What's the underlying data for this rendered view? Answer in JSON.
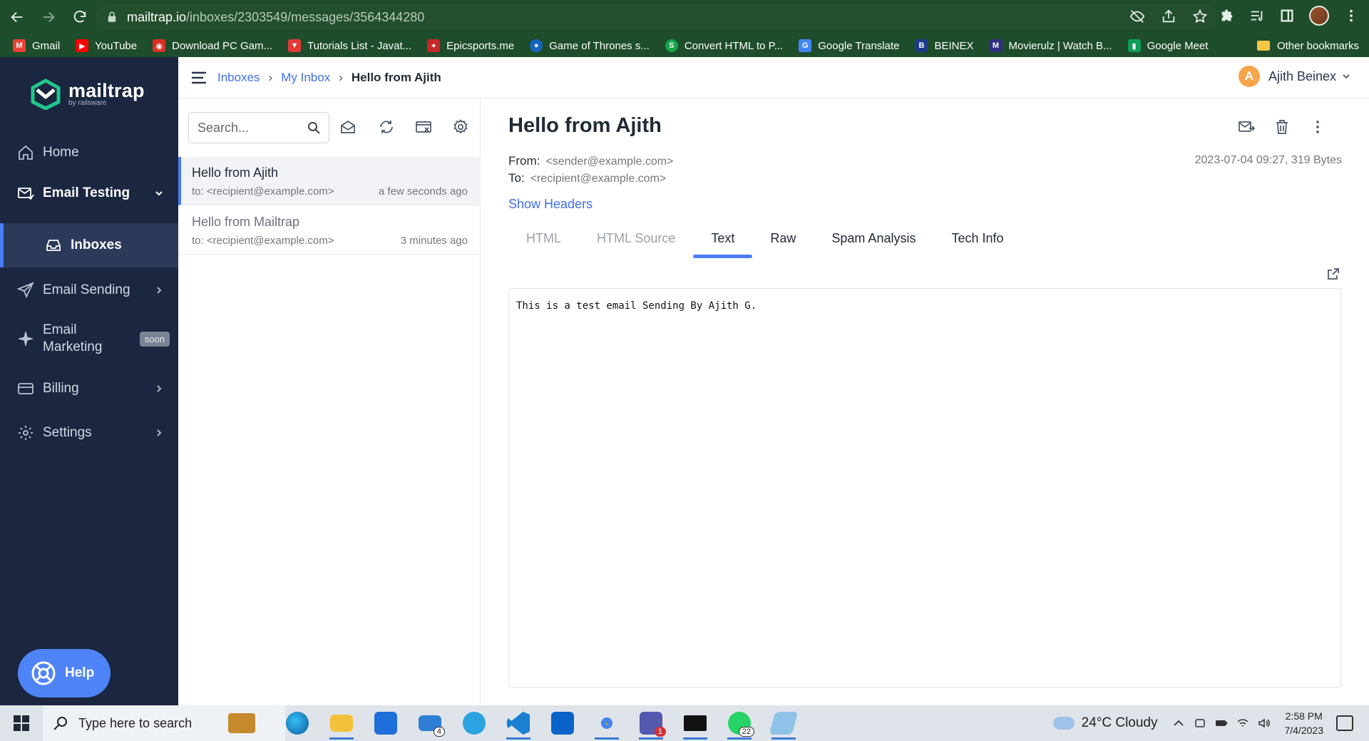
{
  "browser": {
    "url_host": "mailtrap.io",
    "url_path": "/inboxes/2303549/messages/3564344280",
    "bookmarks": [
      {
        "label": "Gmail",
        "color": "#ea4335",
        "glyph": "M"
      },
      {
        "label": "YouTube",
        "color": "#ff0000",
        "glyph": "▶"
      },
      {
        "label": "Download PC Gam...",
        "color": "#d93025",
        "glyph": "◉"
      },
      {
        "label": "Tutorials List - Javat...",
        "color": "#e53935",
        "glyph": "▼"
      },
      {
        "label": "Epicsports.me",
        "color": "#c62828",
        "glyph": "✦"
      },
      {
        "label": "Game of Thrones s...",
        "color": "#1565c0",
        "glyph": "●"
      },
      {
        "label": "Convert HTML to P...",
        "color": "#16a34a",
        "glyph": "S"
      },
      {
        "label": "Google Translate",
        "color": "#4285f4",
        "glyph": "G"
      },
      {
        "label": "BEINEX",
        "color": "#1e3a8a",
        "glyph": "B"
      },
      {
        "label": "Movierulz | Watch B...",
        "color": "#312e81",
        "glyph": "M"
      },
      {
        "label": "Google Meet",
        "color": "#0f9d58",
        "glyph": "▮"
      }
    ],
    "other_bookmarks": "Other bookmarks"
  },
  "sidebar": {
    "logo_name": "mailtrap",
    "logo_sub": "by railsware",
    "home": "Home",
    "email_testing": "Email Testing",
    "inboxes": "Inboxes",
    "email_sending": "Email Sending",
    "email_marketing_1": "Email",
    "email_marketing_2": "Marketing",
    "soon_badge": "soon",
    "billing": "Billing",
    "settings": "Settings",
    "help": "Help"
  },
  "header": {
    "breadcrumb": [
      "Inboxes",
      "My Inbox",
      "Hello from Ajith"
    ],
    "user_initial": "A",
    "user_name": "Ajith Beinex"
  },
  "list": {
    "search_placeholder": "Search...",
    "messages": [
      {
        "subject": "Hello from Ajith",
        "to": "to: <recipient@example.com>",
        "time": "a few seconds ago",
        "selected": true
      },
      {
        "subject": "Hello from Mailtrap",
        "to": "to: <recipient@example.com>",
        "time": "3 minutes ago",
        "selected": false
      }
    ]
  },
  "message": {
    "title": "Hello from Ajith",
    "from_label": "From:",
    "from": "<sender@example.com>",
    "to_label": "To:",
    "to": "<recipient@example.com>",
    "meta": "2023-07-04 09:27, 319 Bytes",
    "show_headers": "Show Headers",
    "tabs": [
      "HTML",
      "HTML Source",
      "Text",
      "Raw",
      "Spam Analysis",
      "Tech Info"
    ],
    "active_tab": "Text",
    "body": "This is a test email Sending By Ajith G."
  },
  "taskbar": {
    "search_placeholder": "Type here to search",
    "mail_badge": "4",
    "teams_badge": "1",
    "whatsapp_badge": "22",
    "weather": "24°C  Cloudy",
    "time": "2:58 PM",
    "date": "7/4/2023"
  },
  "colors": {
    "sidebar_bg": "#1b2640",
    "accent": "#4b7bf5",
    "chrome_bg": "#1e4d2b"
  }
}
